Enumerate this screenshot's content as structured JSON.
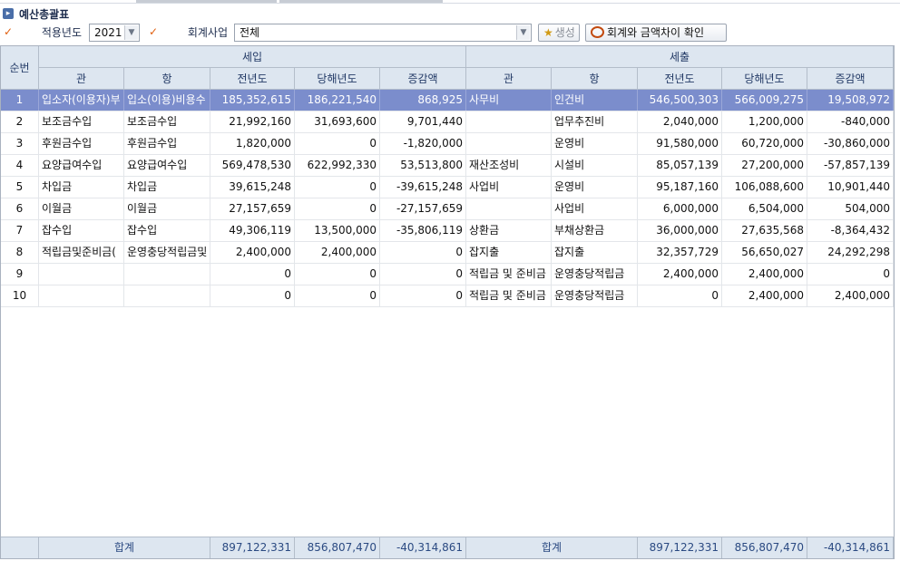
{
  "page": {
    "title": "예산총괄표"
  },
  "filters": {
    "year_label": "적용년도",
    "year_value": "2021",
    "account_label": "회계사업",
    "account_value": "전체",
    "generate_label": "생성",
    "compare_label": "회계와 금액차이 확인"
  },
  "grid": {
    "headers": {
      "seq": "순번",
      "revenue_group": "세입",
      "expense_group": "세출",
      "rev_gwan": "관",
      "rev_hang": "항",
      "rev_prev": "전년도",
      "rev_curr": "당해년도",
      "rev_diff": "증감액",
      "exp_gwan": "관",
      "exp_hang": "항",
      "exp_prev": "전년도",
      "exp_curr": "당해년도",
      "exp_diff": "증감액"
    },
    "selected_row": 0,
    "rows": [
      {
        "seq": "1",
        "rev_gwan": "입소자(이용자)부",
        "rev_hang": "입소(이용)비용수",
        "rev_prev": "185,352,615",
        "rev_curr": "186,221,540",
        "rev_diff": "868,925",
        "exp_gwan": "사무비",
        "exp_hang": "인건비",
        "exp_prev": "546,500,303",
        "exp_curr": "566,009,275",
        "exp_diff": "19,508,972"
      },
      {
        "seq": "2",
        "rev_gwan": "보조금수입",
        "rev_hang": "보조금수입",
        "rev_prev": "21,992,160",
        "rev_curr": "31,693,600",
        "rev_diff": "9,701,440",
        "exp_gwan": "",
        "exp_hang": "업무추진비",
        "exp_prev": "2,040,000",
        "exp_curr": "1,200,000",
        "exp_diff": "-840,000"
      },
      {
        "seq": "3",
        "rev_gwan": "후원금수입",
        "rev_hang": "후원금수입",
        "rev_prev": "1,820,000",
        "rev_curr": "0",
        "rev_diff": "-1,820,000",
        "exp_gwan": "",
        "exp_hang": "운영비",
        "exp_prev": "91,580,000",
        "exp_curr": "60,720,000",
        "exp_diff": "-30,860,000"
      },
      {
        "seq": "4",
        "rev_gwan": "요양급여수입",
        "rev_hang": "요양급여수입",
        "rev_prev": "569,478,530",
        "rev_curr": "622,992,330",
        "rev_diff": "53,513,800",
        "exp_gwan": "재산조성비",
        "exp_hang": "시설비",
        "exp_prev": "85,057,139",
        "exp_curr": "27,200,000",
        "exp_diff": "-57,857,139"
      },
      {
        "seq": "5",
        "rev_gwan": "차입금",
        "rev_hang": "차입금",
        "rev_prev": "39,615,248",
        "rev_curr": "0",
        "rev_diff": "-39,615,248",
        "exp_gwan": "사업비",
        "exp_hang": "운영비",
        "exp_prev": "95,187,160",
        "exp_curr": "106,088,600",
        "exp_diff": "10,901,440"
      },
      {
        "seq": "6",
        "rev_gwan": "이월금",
        "rev_hang": "이월금",
        "rev_prev": "27,157,659",
        "rev_curr": "0",
        "rev_diff": "-27,157,659",
        "exp_gwan": "",
        "exp_hang": "사업비",
        "exp_prev": "6,000,000",
        "exp_curr": "6,504,000",
        "exp_diff": "504,000"
      },
      {
        "seq": "7",
        "rev_gwan": "잡수입",
        "rev_hang": "잡수입",
        "rev_prev": "49,306,119",
        "rev_curr": "13,500,000",
        "rev_diff": "-35,806,119",
        "exp_gwan": "상환금",
        "exp_hang": "부채상환금",
        "exp_prev": "36,000,000",
        "exp_curr": "27,635,568",
        "exp_diff": "-8,364,432"
      },
      {
        "seq": "8",
        "rev_gwan": "적립금및준비금(",
        "rev_hang": "운영충당적립금및",
        "rev_prev": "2,400,000",
        "rev_curr": "2,400,000",
        "rev_diff": "0",
        "exp_gwan": "잡지출",
        "exp_hang": "잡지출",
        "exp_prev": "32,357,729",
        "exp_curr": "56,650,027",
        "exp_diff": "24,292,298"
      },
      {
        "seq": "9",
        "rev_gwan": "",
        "rev_hang": "",
        "rev_prev": "0",
        "rev_curr": "0",
        "rev_diff": "0",
        "exp_gwan": "적립금 및 준비금",
        "exp_hang": "운영충당적립금",
        "exp_prev": "2,400,000",
        "exp_curr": "2,400,000",
        "exp_diff": "0"
      },
      {
        "seq": "10",
        "rev_gwan": "",
        "rev_hang": "",
        "rev_prev": "0",
        "rev_curr": "0",
        "rev_diff": "0",
        "exp_gwan": "적립금 및 준비금",
        "exp_hang": "운영충당적립금",
        "exp_prev": "0",
        "exp_curr": "2,400,000",
        "exp_diff": "2,400,000"
      }
    ],
    "footer": {
      "rev_label": "합계",
      "rev_prev": "897,122,331",
      "rev_curr": "856,807,470",
      "rev_diff": "-40,314,861",
      "exp_label": "합계",
      "exp_prev": "897,122,331",
      "exp_curr": "856,807,470",
      "exp_diff": "-40,314,861"
    }
  }
}
